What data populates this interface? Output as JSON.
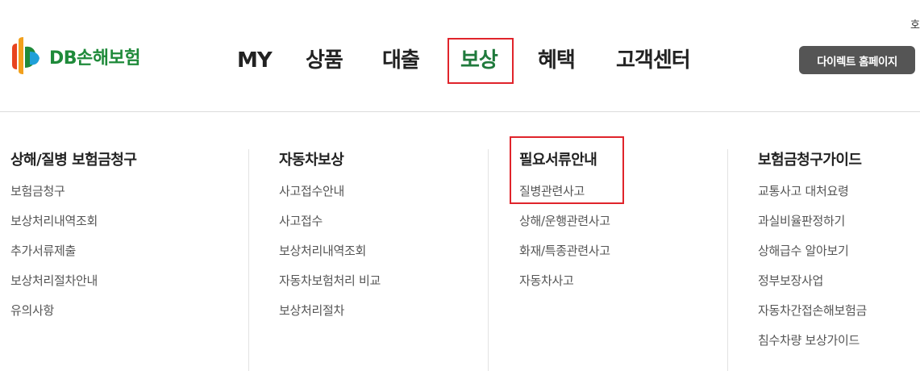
{
  "header": {
    "logo_text": "DB손해보험",
    "top_right_text": "호",
    "direct_button": "다이렉트 홈페이지",
    "highlight_color": "#e0242b",
    "brand_color": "#1f7a3c"
  },
  "gnb": {
    "items": [
      {
        "label": "MY"
      },
      {
        "label": "상품"
      },
      {
        "label": "대출"
      },
      {
        "label": "보상"
      },
      {
        "label": "혜택"
      },
      {
        "label": "고객센터"
      }
    ],
    "active": "보상"
  },
  "menu": {
    "columns": [
      {
        "title": "상해/질병 보험금청구",
        "items": [
          "보험금청구",
          "보상처리내역조회",
          "추가서류제출",
          "보상처리절차안내",
          "유의사항"
        ]
      },
      {
        "title": "자동차보상",
        "items": [
          "사고접수안내",
          "사고접수",
          "보상처리내역조회",
          "자동차보험처리 비교",
          "보상처리절차"
        ]
      },
      {
        "title": "필요서류안내",
        "items": [
          "질병관련사고",
          "상해/운행관련사고",
          "화재/특종관련사고",
          "자동차사고"
        ]
      },
      {
        "title": "보험금청구가이드",
        "items": [
          "교통사고 대처요령",
          "과실비율판정하기",
          "상해급수 알아보기",
          "정부보장사업",
          "자동차간접손해보험금",
          "침수차량 보상가이드"
        ]
      }
    ]
  }
}
